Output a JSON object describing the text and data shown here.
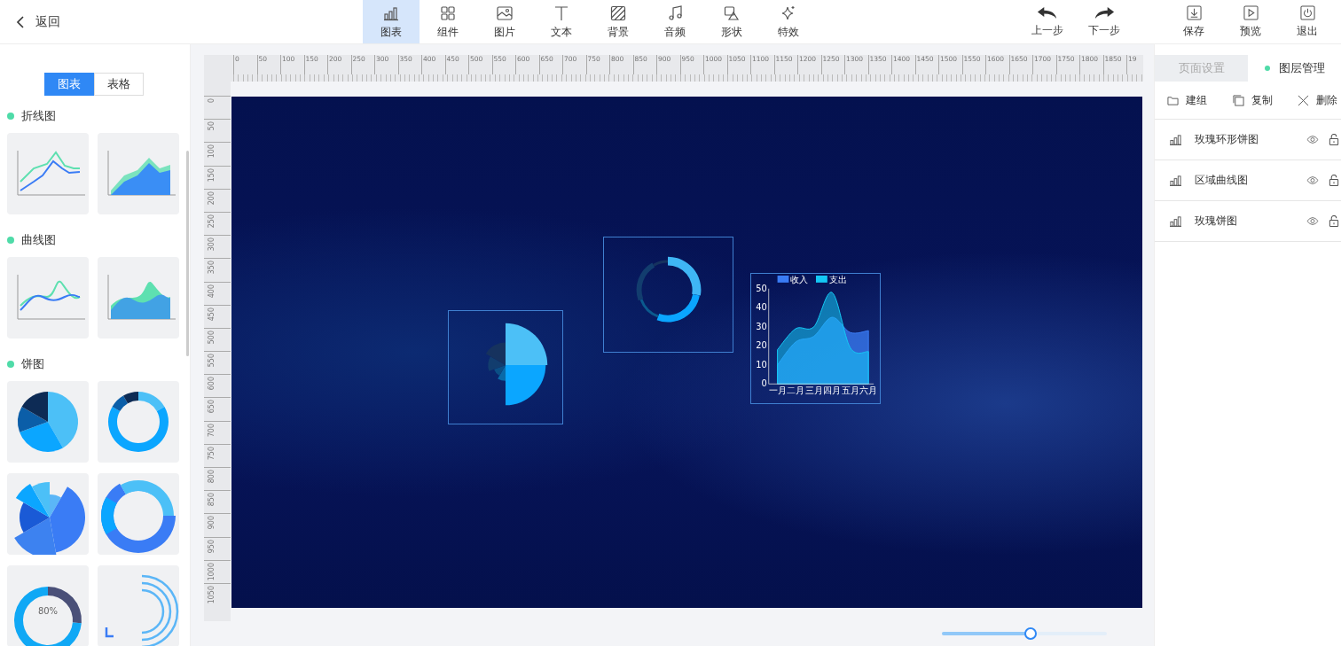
{
  "header": {
    "back": "返回",
    "tools": [
      {
        "label": "图表",
        "selected": true
      },
      {
        "label": "组件",
        "selected": false
      },
      {
        "label": "图片",
        "selected": false
      },
      {
        "label": "文本",
        "selected": false
      },
      {
        "label": "背景",
        "selected": false
      },
      {
        "label": "音频",
        "selected": false
      },
      {
        "label": "形状",
        "selected": false
      },
      {
        "label": "特效",
        "selected": false
      }
    ],
    "history": [
      "上一步",
      "下一步"
    ],
    "actions": [
      "保存",
      "预览",
      "退出"
    ]
  },
  "library": {
    "tabs": [
      {
        "label": "图表",
        "selected": true
      },
      {
        "label": "表格",
        "selected": false
      }
    ],
    "sections": [
      {
        "title": "折线图",
        "thumbnails": [
          {
            "kind": "line"
          },
          {
            "kind": "line-area"
          }
        ]
      },
      {
        "title": "曲线图",
        "thumbnails": [
          {
            "kind": "curve"
          },
          {
            "kind": "curve-area"
          }
        ]
      },
      {
        "title": "饼图",
        "thumbnails": [
          {
            "kind": "pie"
          },
          {
            "kind": "ring"
          },
          {
            "kind": "rose"
          },
          {
            "kind": "rose-ring"
          },
          {
            "kind": "gauge",
            "label": "80%"
          },
          {
            "kind": "radial-bar"
          }
        ]
      }
    ]
  },
  "rulers": {
    "x_labels": [
      "0",
      "50",
      "100",
      "150",
      "200",
      "250",
      "300",
      "350",
      "400",
      "450",
      "500",
      "550",
      "600",
      "650",
      "700",
      "750",
      "800",
      "850",
      "900",
      "950",
      "1000",
      "1050",
      "1100",
      "1150",
      "1200",
      "1250",
      "1300",
      "1350",
      "1400",
      "1450",
      "1500",
      "1550",
      "1600",
      "1650",
      "1700",
      "1750",
      "1800",
      "1850",
      "19"
    ],
    "y_labels": [
      "0",
      "50",
      "100",
      "150",
      "200",
      "250",
      "300",
      "350",
      "400",
      "450",
      "500",
      "550",
      "600",
      "650",
      "700",
      "750",
      "800",
      "850",
      "900",
      "950",
      "1000",
      "1050"
    ]
  },
  "canvas": {
    "widgets": [
      {
        "kind": "rose-pie"
      },
      {
        "kind": "ring-pie"
      },
      {
        "kind": "area-chart",
        "chart_data": {
          "type": "area",
          "categories": [
            "一月",
            "二月",
            "三月",
            "四月",
            "五月",
            "六月"
          ],
          "series": [
            {
              "name": "收入",
              "color": "#3a7cf5",
              "values": [
                10,
                22,
                25,
                35,
                27,
                28
              ]
            },
            {
              "name": "支出",
              "color": "#14c8f5",
              "values": [
                18,
                29,
                30,
                48,
                19,
                17
              ]
            }
          ],
          "ylim": [
            0,
            50
          ],
          "yticks": [
            0,
            10,
            20,
            30,
            40,
            50
          ],
          "legend": "top"
        }
      }
    ]
  },
  "zoom": {
    "level": 0.53
  },
  "panel": {
    "tabs": [
      {
        "label": "页面设置",
        "selected": false
      },
      {
        "label": "图层管理",
        "selected": true
      }
    ],
    "actions": [
      "建组",
      "复制",
      "删除"
    ],
    "layers": [
      {
        "name": "玫瑰环形饼图"
      },
      {
        "name": "区域曲线图"
      },
      {
        "name": "玫瑰饼图"
      }
    ]
  }
}
